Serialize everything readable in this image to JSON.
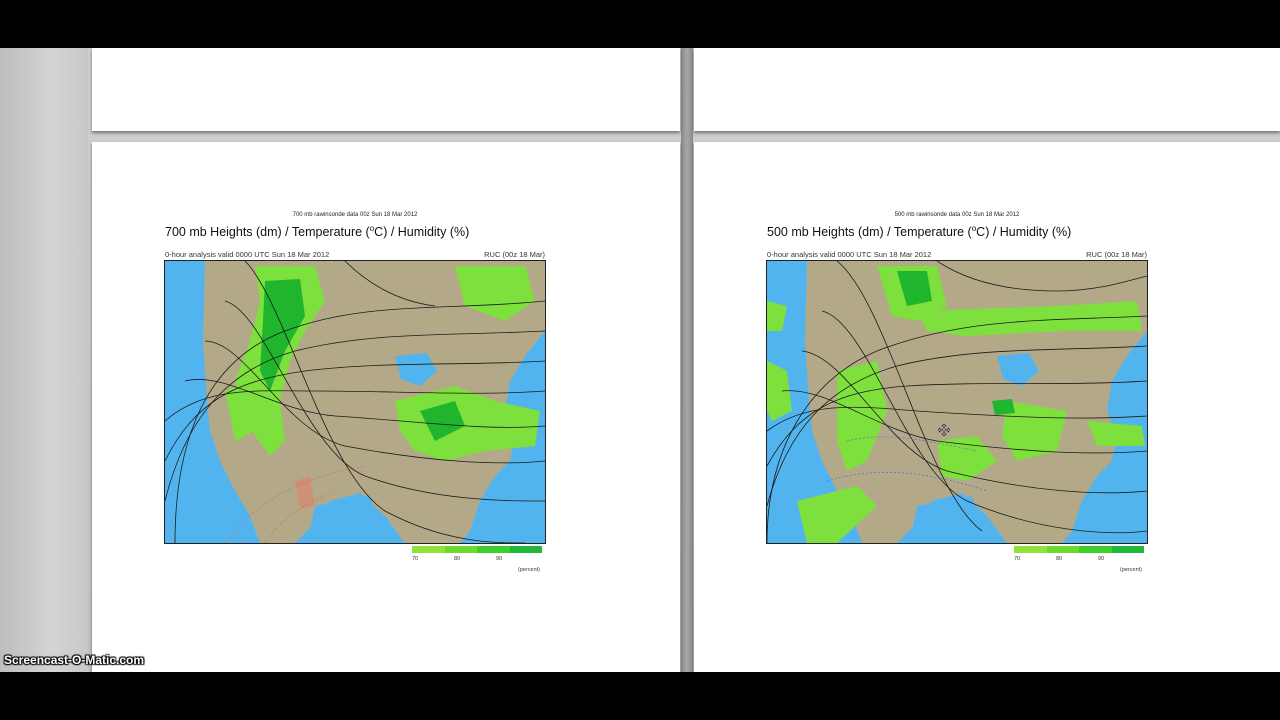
{
  "watermark": "Screencast-O-Matic.com",
  "legend": {
    "ticks": [
      "70",
      "80",
      "90"
    ],
    "unit": "(percent)",
    "colors": [
      "#8fe33a",
      "#6ddb2e",
      "#3ecf2d",
      "#22b83a"
    ]
  },
  "charts": [
    {
      "sup_title": "700 mb  rawinsonde data 00z Sun 18 Mar 2012",
      "title_pre": "700 mb Heights (dm) / Temperature (",
      "title_sup": "o",
      "title_post": "C) / Humidity (%)",
      "valid": "0-hour analysis valid 0000 UTC Sun 18 Mar 2012",
      "model": "RUC (00z 18 Mar)"
    },
    {
      "sup_title": "500 mb  rawinsonde data 00z Sun 18 Mar 2012",
      "title_pre": "500 mb Heights (dm) / Temperature (",
      "title_sup": "o",
      "title_post": "C) / Humidity (%)",
      "valid": "0-hour analysis valid 0000 UTC Sun 18 Mar 2012",
      "model": "RUC (00z 18 Mar)"
    }
  ],
  "colors": {
    "ocean": "#52b4ef",
    "land": "#b3a989",
    "humid_light": "#7ee03c",
    "humid_dark": "#1fb52c",
    "contour": "#1a1a1a"
  }
}
